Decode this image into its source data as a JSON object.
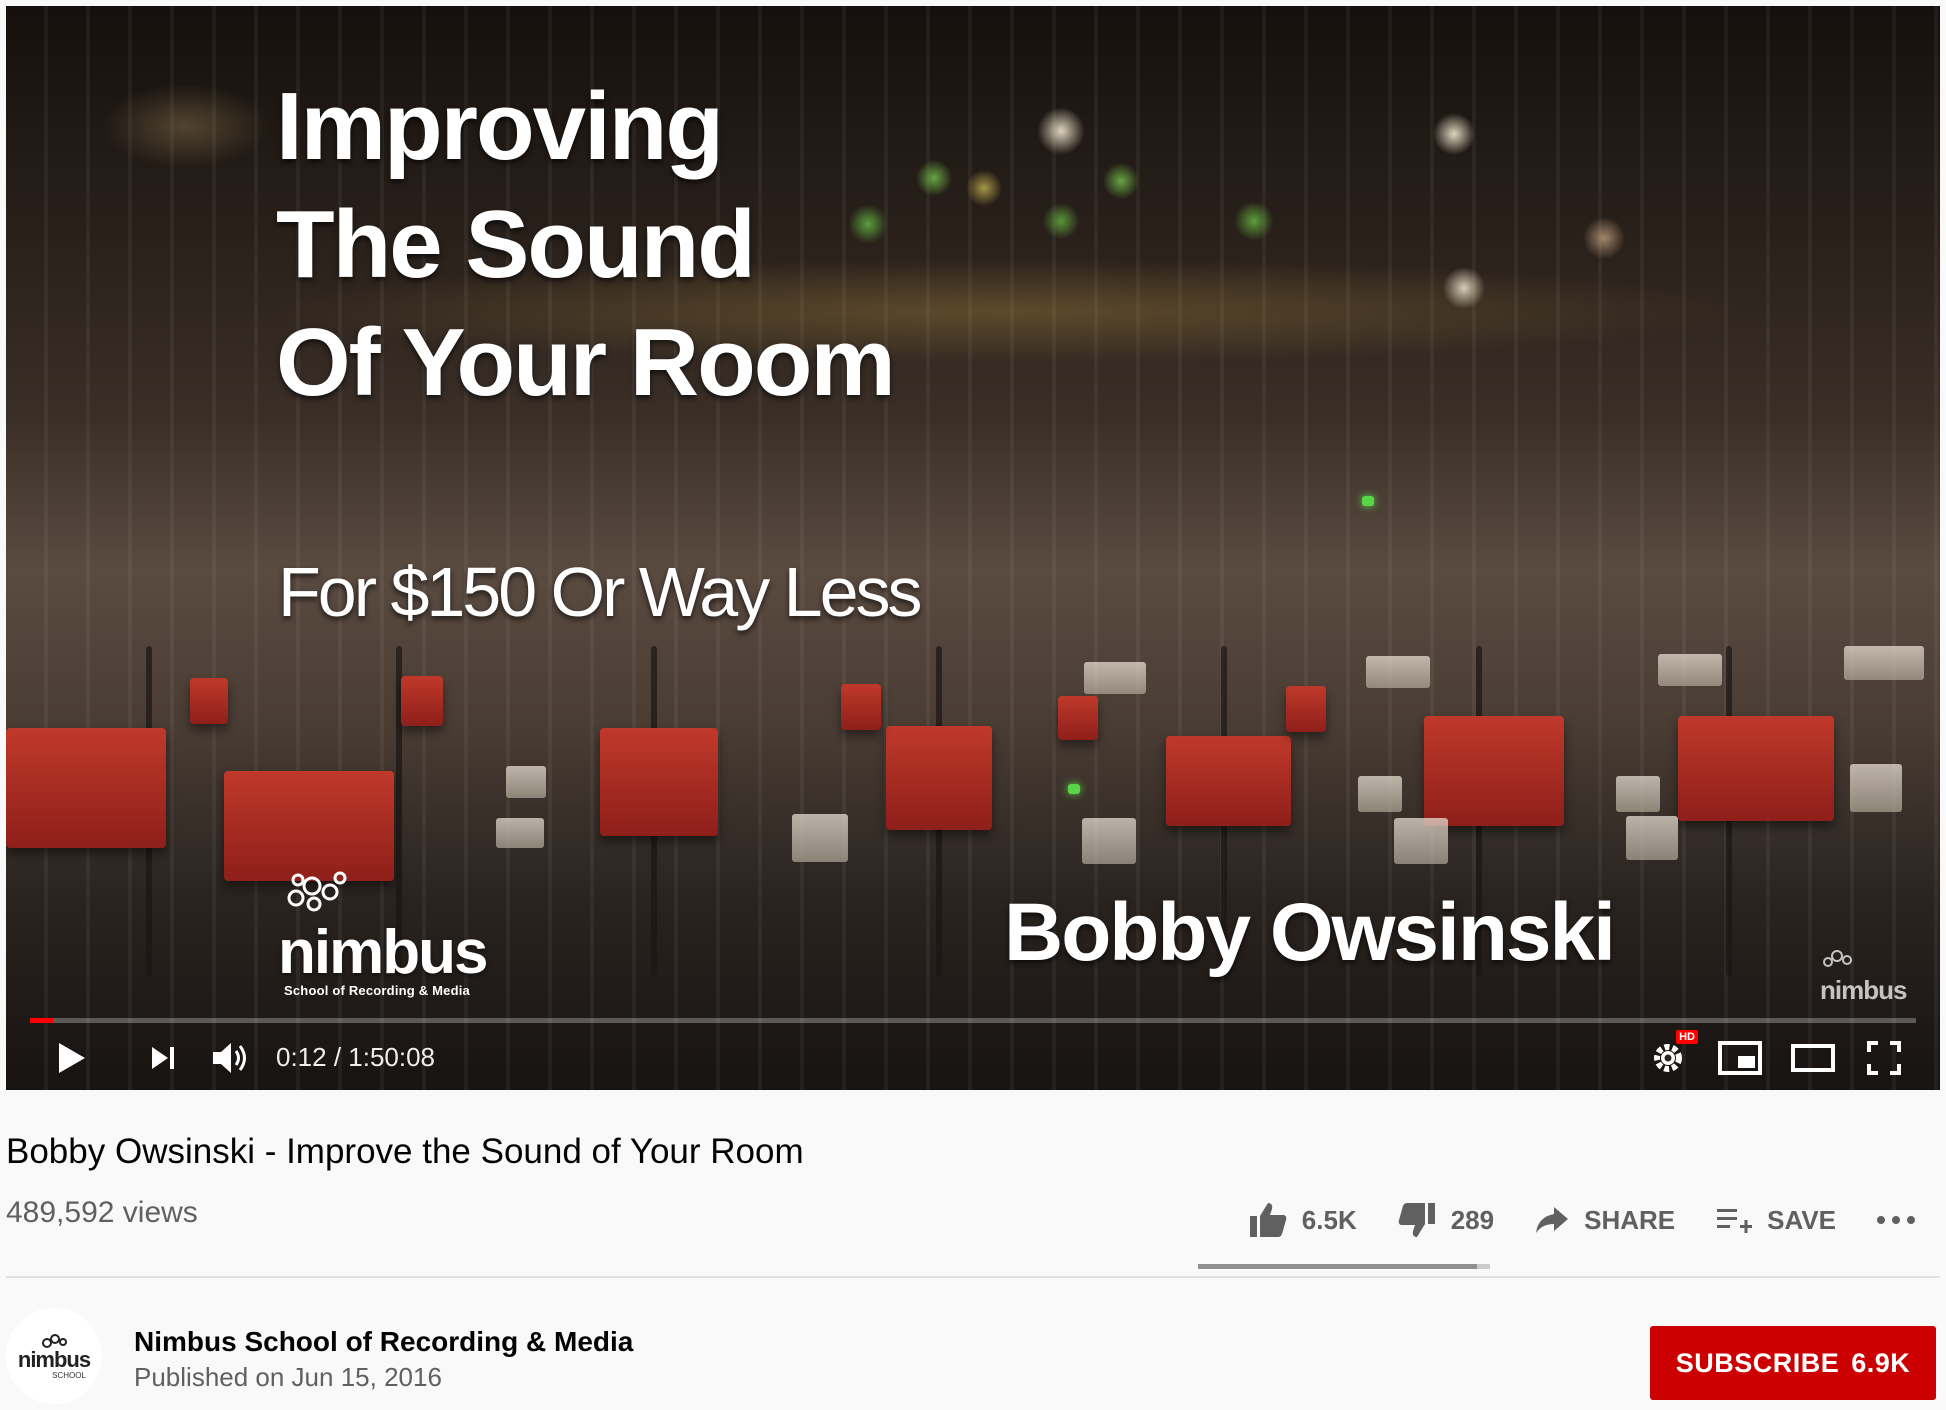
{
  "video": {
    "overlay_title_lines": [
      "Improving",
      "The Sound",
      "Of Your Room"
    ],
    "overlay_subtitle": "For $150 Or Way Less",
    "overlay_presenter": "Bobby Owsinski",
    "logo_word": "nimbus",
    "logo_sub": "School of Recording & Media",
    "watermark_word": "nimbus",
    "progress_fraction": 0.0018
  },
  "player_controls": {
    "time": "0:12 / 1:50:08",
    "hd_badge": "HD",
    "icons": [
      "play-icon",
      "next-icon",
      "volume-icon",
      "settings-icon",
      "miniplayer-icon",
      "theater-icon",
      "fullscreen-icon"
    ]
  },
  "info": {
    "title": "Bobby Owsinski - Improve the Sound of Your Room",
    "views": "489,592 views",
    "likes": "6.5K",
    "dislikes": "289",
    "share_label": "SHARE",
    "save_label": "SAVE",
    "like_ratio": 0.957
  },
  "channel": {
    "name": "Nimbus School of Recording & Media",
    "published": "Published on Jun 15, 2016",
    "avatar_word": "nimbus",
    "avatar_sub": "SCHOOL",
    "subscribe_label": "SUBSCRIBE",
    "subscriber_count": "6.9K"
  },
  "colors": {
    "subscribe_bg": "#cc0000",
    "progress": "#ff0000",
    "secondary_text": "#606060"
  }
}
